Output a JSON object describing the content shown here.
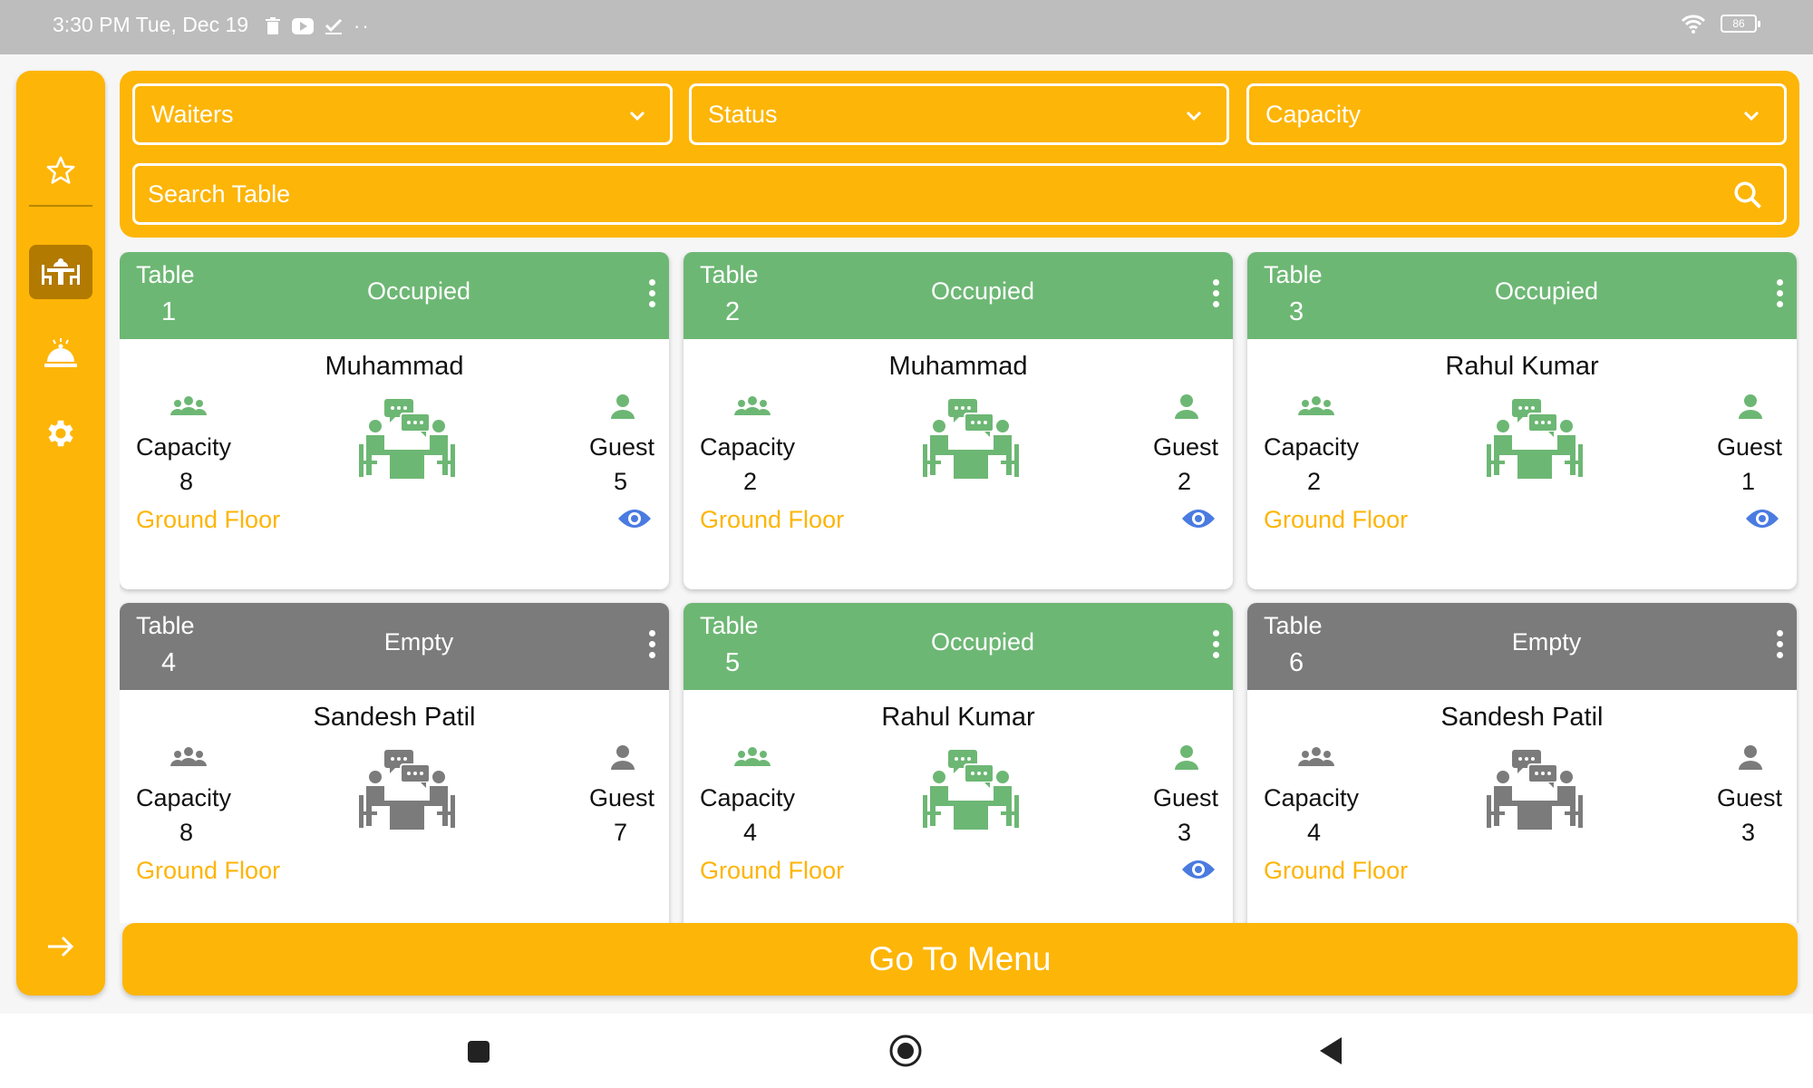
{
  "status_bar": {
    "time": "3:30 PM Tue, Dec 19",
    "battery": "86"
  },
  "sidebar": {
    "items": [
      {
        "icon": "star-outline-icon"
      },
      {
        "icon": "dining-table-icon",
        "active": true
      },
      {
        "icon": "service-bell-icon"
      },
      {
        "icon": "gear-icon"
      },
      {
        "icon": "arrow-right-icon"
      }
    ]
  },
  "filters": {
    "waiters_label": "Waiters",
    "status_label": "Status",
    "capacity_label": "Capacity",
    "search_placeholder": "Search Table"
  },
  "tables": [
    {
      "label": "Table",
      "number": "1",
      "status": "Occupied",
      "waiter": "Muhammad",
      "capacity_label": "Capacity",
      "capacity": "8",
      "guest_label": "Guest",
      "guests": "5",
      "floor": "Ground Floor",
      "viewable": true
    },
    {
      "label": "Table",
      "number": "2",
      "status": "Occupied",
      "waiter": "Muhammad",
      "capacity_label": "Capacity",
      "capacity": "2",
      "guest_label": "Guest",
      "guests": "2",
      "floor": "Ground Floor",
      "viewable": true
    },
    {
      "label": "Table",
      "number": "3",
      "status": "Occupied",
      "waiter": "Rahul Kumar",
      "capacity_label": "Capacity",
      "capacity": "2",
      "guest_label": "Guest",
      "guests": "1",
      "floor": "Ground Floor",
      "viewable": true
    },
    {
      "label": "Table",
      "number": "4",
      "status": "Empty",
      "waiter": "Sandesh Patil",
      "capacity_label": "Capacity",
      "capacity": "8",
      "guest_label": "Guest",
      "guests": "7",
      "floor": "Ground Floor",
      "viewable": false
    },
    {
      "label": "Table",
      "number": "5",
      "status": "Occupied",
      "waiter": "Rahul Kumar",
      "capacity_label": "Capacity",
      "capacity": "4",
      "guest_label": "Guest",
      "guests": "3",
      "floor": "Ground Floor",
      "viewable": true
    },
    {
      "label": "Table",
      "number": "6",
      "status": "Empty",
      "waiter": "Sandesh Patil",
      "capacity_label": "Capacity",
      "capacity": "4",
      "guest_label": "Guest",
      "guests": "3",
      "floor": "Ground Floor",
      "viewable": false
    }
  ],
  "go_to_menu_label": "Go To Menu",
  "colors": {
    "accent": "#fdb507",
    "occupied": "#6db774",
    "empty": "#7b7b7b",
    "eye": "#4a7be0"
  }
}
